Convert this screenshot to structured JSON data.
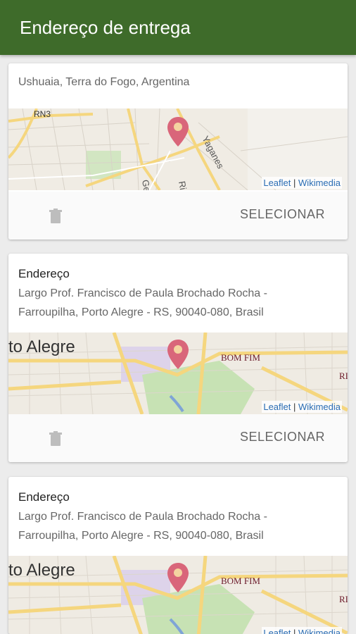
{
  "appbar": {
    "title": "Endereço de entrega"
  },
  "colors": {
    "appbar": "#3e6b2a",
    "pin": "#d9667a",
    "map_road": "#f5d67e",
    "map_park": "#c7e2b4"
  },
  "cards": [
    {
      "address": "Ushuaia, Terra do Fogo, Argentina",
      "map": {
        "attrib_leaflet": "Leaflet",
        "attrib_sep": "|",
        "attrib_wiki": "Wikimedia",
        "labels": [
          "RN3",
          "Yaganes",
          "Ge",
          "Ri"
        ]
      },
      "delete_icon": "trash-icon",
      "select_label": "SELECIONAR"
    },
    {
      "name": "Endereço",
      "address": "Largo Prof. Francisco de Paula Brochado Rocha - Farroupilha, Porto Alegre - RS, 90040-080, Brasil",
      "map": {
        "attrib_leaflet": "Leaflet",
        "attrib_sep": "|",
        "attrib_wiki": "Wikimedia",
        "labels": [
          "to Alegre",
          "BOM FIM",
          "RI"
        ]
      },
      "delete_icon": "trash-icon",
      "select_label": "SELECIONAR"
    },
    {
      "name": "Endereço",
      "address": "Largo Prof. Francisco de Paula Brochado Rocha - Farroupilha, Porto Alegre - RS, 90040-080, Brasil",
      "map": {
        "attrib_leaflet": "Leaflet",
        "attrib_sep": "|",
        "attrib_wiki": "Wikimedia",
        "labels": [
          "to Alegre",
          "BOM FIM",
          "RI"
        ]
      }
    }
  ]
}
